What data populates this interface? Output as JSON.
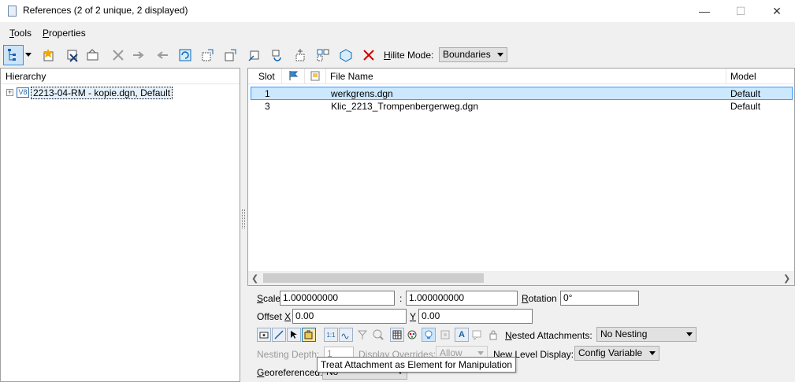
{
  "window": {
    "title": "References (2 of 2 unique, 2 displayed)",
    "minimize": "—",
    "maximize": "☐",
    "close": "✕"
  },
  "menu": {
    "tools_first": "T",
    "tools_rest": "ools",
    "properties_first": "P",
    "properties_rest": "roperties"
  },
  "toolbar": {
    "hilite_first": "H",
    "hilite_rest": "ilite Mode:",
    "hilite_value": "Boundaries"
  },
  "hierarchy": {
    "header": "Hierarchy",
    "expander": "+",
    "node_badge": "V8",
    "node_label": "2213-04-RM - kopie.dgn, Default"
  },
  "list": {
    "columns": {
      "slot": "Slot",
      "file_name": "File Name",
      "model": "Model"
    },
    "rows": [
      {
        "slot": "1",
        "file": "werkgrens.dgn",
        "model": "Default",
        "selected": true
      },
      {
        "slot": "3",
        "file": "Klic_2213_Trompenbergerweg.dgn",
        "model": "Default",
        "selected": false
      }
    ]
  },
  "settings": {
    "scale_first": "S",
    "scale_rest": "cale",
    "scale_1": "1.000000000",
    "scale_sep": ":",
    "scale_2": "1.000000000",
    "rotation_first": "R",
    "rotation_rest": "otation",
    "rotation": "0°",
    "offset_label": "Offset ",
    "offset_x_first": "X",
    "offset_x": "0.00",
    "offset_y_first": "Y",
    "offset_y": "0.00",
    "nested_first": "N",
    "nested_rest": "ested Attachments:",
    "nested_value": "No Nesting",
    "nesting_depth_label": "Nesting Depth:",
    "nesting_depth": "1",
    "display_overrides_label": "Display Overrides:",
    "display_overrides": "Allow",
    "new_level_first": "N",
    "new_level_rest": "ew Level Display:",
    "new_level_value": "Config Variable",
    "georef_first": "G",
    "georef_rest": "eoreferenced:",
    "georef_value": "No"
  },
  "tooltip": "Treat Attachment as Element for Manipulation",
  "colors": {
    "selection": "#cce8ff",
    "selection_border": "#3399ff",
    "accent": "#0078d7"
  }
}
